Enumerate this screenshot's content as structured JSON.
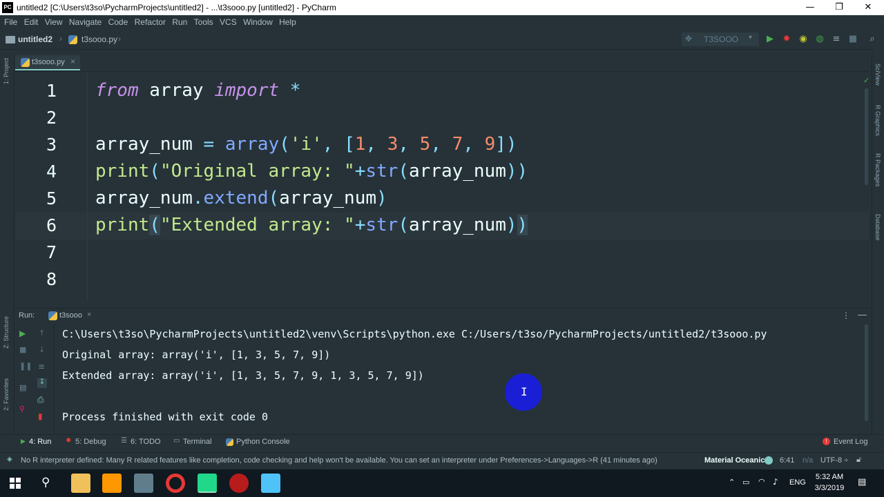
{
  "window": {
    "app_icon": "PC",
    "title": "untitled2 [C:\\Users\\t3so\\PycharmProjects\\untitled2] - ...\\t3sooo.py [untitled2] - PyCharm",
    "minimize": "—",
    "maximize": "❐",
    "close": "✕"
  },
  "menu": [
    "File",
    "Edit",
    "View",
    "Navigate",
    "Code",
    "Refactor",
    "Run",
    "Tools",
    "VCS",
    "Window",
    "Help"
  ],
  "breadcrumb": {
    "project": "untitled2",
    "file": "t3sooo.py"
  },
  "run_config": {
    "name": "T3SOOO"
  },
  "editor_tab": {
    "label": "t3sooo.py",
    "close": "×"
  },
  "left_strip": {
    "project": "1: Project",
    "structure": "Z: Structure",
    "favorites": "2: Favorites"
  },
  "right_strip": {
    "sciview": "SciView",
    "rgraphics": "R Graphics",
    "rpackages": "R Packages",
    "database": "Database"
  },
  "line_numbers": [
    "1",
    "2",
    "3",
    "4",
    "5",
    "6",
    "7",
    "8"
  ],
  "code": {
    "l1": {
      "kw1": "from",
      "mod": " array ",
      "kw2": "import",
      "star": " *"
    },
    "l3": {
      "a": "array_num ",
      "eq": "=",
      "b": " ",
      "fn": "array",
      "p1": "(",
      "s": "'i'",
      "c": ", ",
      "br1": "[",
      "n1": "1",
      "c1": ", ",
      "n2": "3",
      "c2": ", ",
      "n3": "5",
      "c3": ", ",
      "n4": "7",
      "c4": ", ",
      "n5": "9",
      "br2": "]",
      "p2": ")"
    },
    "l4": {
      "fn": "print",
      "p1": "(",
      "s": "\"Original array: \"",
      "plus": "+",
      "bi": "str",
      "p2": "(",
      "v": "array_num",
      "p3": "))"
    },
    "l5": {
      "v": "array_num",
      "dot": ".",
      "fn": "extend",
      "p1": "(",
      "a": "array_num",
      "p2": ")"
    },
    "l6": {
      "fn": "print",
      "p1": "(",
      "s": "\"Extended array: \"",
      "plus": "+",
      "bi": "str",
      "p2": "(",
      "v": "array_num",
      "p3": ")",
      "p4": ")"
    }
  },
  "run_panel": {
    "label": "Run:",
    "tab": "t3sooo",
    "tab_close": "×",
    "output": [
      "C:\\Users\\t3so\\PycharmProjects\\untitled2\\venv\\Scripts\\python.exe C:/Users/t3so/PycharmProjects/untitled2/t3sooo.py",
      "Original array: array('i', [1, 3, 5, 7, 9])",
      "Extended array: array('i', [1, 3, 5, 7, 9, 1, 3, 5, 7, 9])",
      "",
      "Process finished with exit code 0"
    ]
  },
  "bottom_tabs": {
    "run": "4: Run",
    "debug": "5: Debug",
    "todo": "6: TODO",
    "terminal": "Terminal",
    "python_console": "Python Console",
    "event_log": "Event Log"
  },
  "status": {
    "message": "No R interpreter defined: Many R related features like completion, code checking and help won't be available. You can set an interpreter under Preferences->Languages->R (41 minutes ago)",
    "theme": "Material Oceanic",
    "position": "6:41",
    "na": "n/a",
    "encoding": "UTF-8 ÷"
  },
  "taskbar": {
    "lang": "ENG",
    "time": "5:32 AM",
    "date": "3/3/2019"
  },
  "colors": {
    "bg": "#263238",
    "keyword": "#c792ea",
    "function": "#82aaff",
    "string": "#c3e88d",
    "number": "#f78c6c",
    "operator": "#89ddff",
    "accent": "#80cbc4"
  }
}
